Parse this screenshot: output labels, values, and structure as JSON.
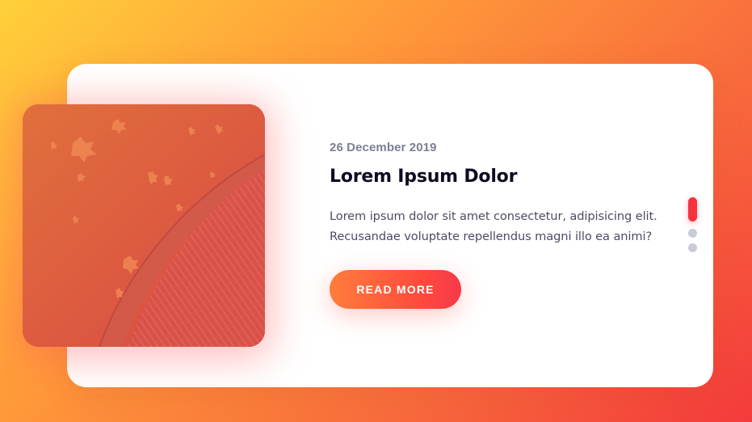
{
  "post": {
    "date": "26 December 2019",
    "title": "Lorem Ipsum Dolor",
    "description": "Lorem ipsum dolor sit amet consectetur, adipisicing elit. Recusandae voluptate repellendus magni illo ea animi?",
    "button_label": "READ MORE"
  },
  "slider": {
    "total_slides": 3,
    "active_index": 1
  },
  "colors": {
    "accent": "#f7333f",
    "button_start": "#ff7d3c",
    "button_end": "#f7384a",
    "title": "#0d0c22",
    "date": "#7b7f94",
    "body_text": "#4e4a67",
    "dot_inactive": "#c9ccd8"
  }
}
